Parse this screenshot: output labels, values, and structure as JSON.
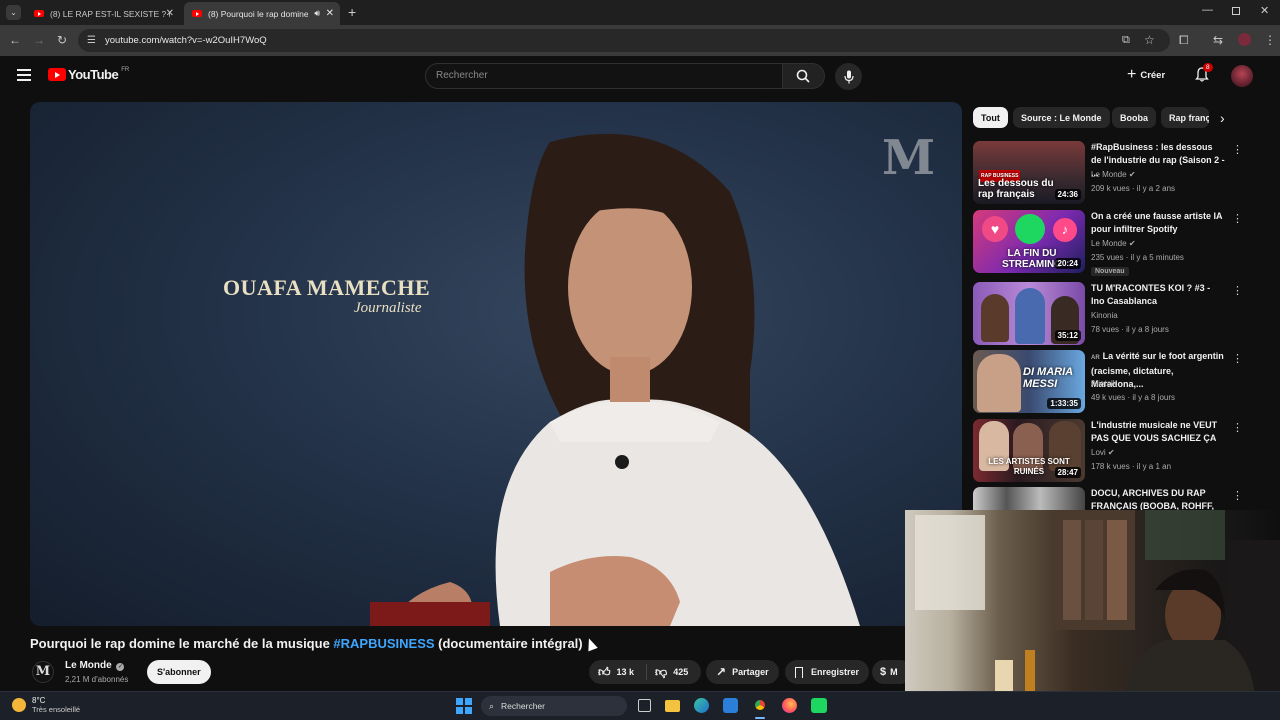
{
  "browser": {
    "tabs": [
      {
        "label": "(8) LE RAP EST-IL SEXISTE ? (4 P",
        "active": false
      },
      {
        "label": "(8) Pourquoi le rap domine",
        "active": true
      }
    ],
    "url": "youtube.com/watch?v=-w2OuIH7WoQ"
  },
  "header": {
    "logo": "YouTube",
    "region": "FR",
    "search_placeholder": "Rechercher",
    "create_label": "Créer",
    "notif_count": "8"
  },
  "video": {
    "lower_third_name": "OUAFA MAMECHE",
    "lower_third_role": "Journaliste",
    "watermark": "M",
    "title_part1": "Pourquoi le rap domine le marché de la musique ",
    "title_hashtag": "#RAPBUSINESS",
    "title_part2": " (documentaire intégral)",
    "channel": "Le Monde",
    "subscribers": "2,21 M d'abonnés",
    "subscribe_label": "S'abonner",
    "likes": "13 k",
    "dislikes": "425",
    "share_label": "Partager",
    "save_label": "Enregistrer",
    "more_label": "M"
  },
  "chips": [
    {
      "label": "Tout",
      "active": true
    },
    {
      "label": "Source : Le Monde",
      "active": false
    },
    {
      "label": "Booba",
      "active": false
    },
    {
      "label": "Rap franç",
      "active": false
    }
  ],
  "recommendations": [
    {
      "title": "#RapBusiness : les dessous de l'industrie du rap (Saison 2 - ...",
      "channel": "Le Monde",
      "verified": true,
      "meta": "209 k vues · il y a 2 ans",
      "duration": "24:36",
      "thumb_text": "Les dessous du rap français",
      "thumb_tag": "RAP BUSINESS",
      "badge": ""
    },
    {
      "title": "On a créé une fausse artiste IA pour infiltrer Spotify",
      "channel": "Le Monde",
      "verified": true,
      "meta": "235 vues · il y a 5 minutes",
      "duration": "20:24",
      "thumb_text": "LA FIN DU STREAMING",
      "thumb_tag": "",
      "badge": "Nouveau"
    },
    {
      "title": "TU M'RACONTES KOI ? #3 - Ino Casablanca",
      "channel": "Kinonia",
      "verified": false,
      "meta": "78 vues · il y a 8 jours",
      "duration": "35:12",
      "thumb_text": "",
      "thumb_tag": "",
      "badge": ""
    },
    {
      "title": "La vérité sur le foot argentin (racisme, dictature, Maradona,...",
      "title_prefix": "AR",
      "channel": "Aliotalk",
      "verified": false,
      "meta": "49 k vues · il y a 8 jours",
      "duration": "1:33:35",
      "thumb_text": "DI MARIA MESSI",
      "thumb_tag": "",
      "badge": ""
    },
    {
      "title": "L'industrie musicale ne VEUT PAS QUE VOUS SACHIEZ ÇA",
      "channel": "Lovi",
      "verified": true,
      "meta": "178 k vues · il y a 1 an",
      "duration": "28:47",
      "thumb_text": "LES ARTISTES SONT RUINÉS",
      "thumb_tag": "",
      "badge": ""
    },
    {
      "title": "DOCU, ARCHIVES DU RAP FRANÇAIS (BOOBA, ROHFF, RI...",
      "channel": "",
      "verified": false,
      "meta": "",
      "duration": "",
      "thumb_text": "",
      "thumb_tag": "",
      "badge": ""
    }
  ],
  "taskbar": {
    "temperature": "8°C",
    "weather": "Très ensoleillé",
    "search_label": "Rechercher"
  },
  "colors": {
    "youtube_red": "#ff0000",
    "hashtag_blue": "#3ea6ff",
    "background": "#0f0f0f"
  }
}
